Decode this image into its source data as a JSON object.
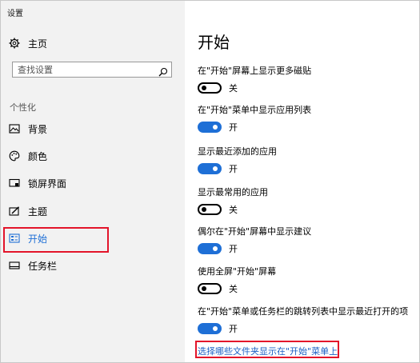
{
  "app": {
    "title": "设置"
  },
  "sidebar": {
    "home_label": "主页",
    "search": {
      "placeholder": "查找设置",
      "value": ""
    },
    "section_label": "个性化",
    "items": [
      {
        "label": "背景",
        "icon": "image-icon"
      },
      {
        "label": "颜色",
        "icon": "palette-icon"
      },
      {
        "label": "锁屏界面",
        "icon": "lock-screen-icon"
      },
      {
        "label": "主题",
        "icon": "theme-icon"
      },
      {
        "label": "开始",
        "icon": "start-icon",
        "selected": true
      },
      {
        "label": "任务栏",
        "icon": "taskbar-icon"
      }
    ]
  },
  "main": {
    "title": "开始",
    "settings": [
      {
        "label": "在\"开始\"屏幕上显示更多磁贴",
        "state": "关",
        "on": false
      },
      {
        "label": "在\"开始\"菜单中显示应用列表",
        "state": "开",
        "on": true
      },
      {
        "label": "显示最近添加的应用",
        "state": "开",
        "on": true
      },
      {
        "label": "显示最常用的应用",
        "state": "关",
        "on": false
      },
      {
        "label": "偶尔在\"开始\"屏幕中显示建议",
        "state": "开",
        "on": true
      },
      {
        "label": "使用全屏\"开始\"屏幕",
        "state": "关",
        "on": false
      },
      {
        "label": "在\"开始\"菜单或任务栏的跳转列表中显示最近打开的项",
        "state": "开",
        "on": true
      }
    ],
    "link_label": "选择哪些文件夹显示在\"开始\"菜单上"
  },
  "colors": {
    "accent": "#1e6fd6",
    "highlight": "#e3142a",
    "sidebar_bg": "#f2f2f2",
    "link": "#1a5fc4"
  }
}
